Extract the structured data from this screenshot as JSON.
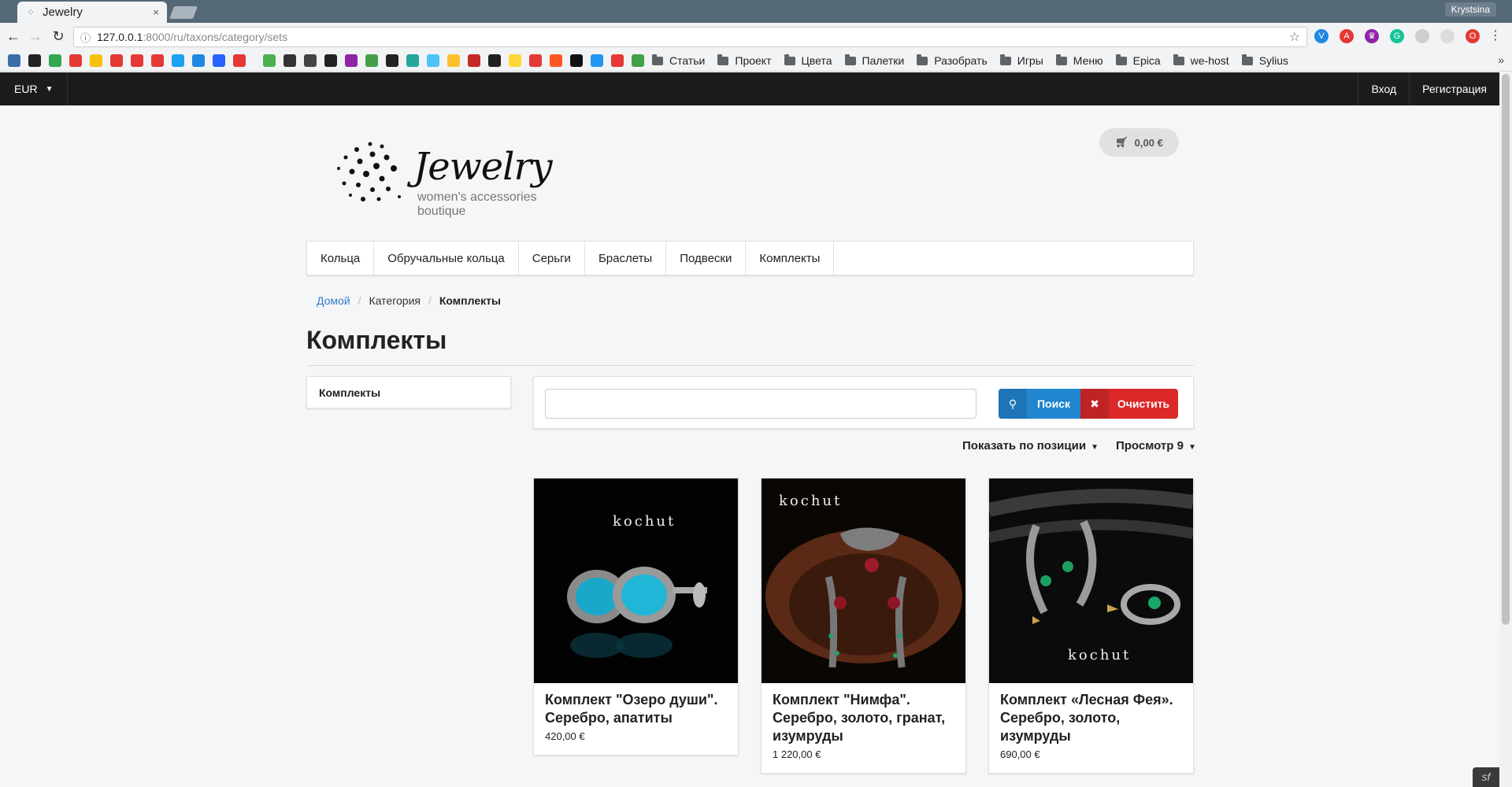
{
  "browser": {
    "tab_title": "Jewelry",
    "tab_close": "×",
    "profile_name": "Krystsina",
    "url_host": "127.0.0.1",
    "url_path": ":8000/ru/taxons/category/sets"
  },
  "bookmarks": {
    "folders": [
      "Статьи",
      "Проект",
      "Цвета",
      "Палетки",
      "Разобрать",
      "Игры",
      "Меню",
      "Epica",
      "we-host",
      "Sylius"
    ],
    "icon_colors": [
      "#3b6ea8",
      "#222222",
      "#32a852",
      "#e53935",
      "#f4c20d",
      "#e53935",
      "#e53935",
      "#e53935",
      "#1da1f2",
      "#1e88e5",
      "#2962ff",
      "#e53935",
      "#4caf50",
      "#333333",
      "#444444",
      "#222222",
      "#8e24aa",
      "#43a047",
      "#222222",
      "#26a69a",
      "#4fc3f7",
      "#fbc02d",
      "#c62828",
      "#212121",
      "#fdd835",
      "#e53935",
      "#ff5722",
      "#111111",
      "#2196f3",
      "#e53935",
      "#43a047"
    ]
  },
  "site": {
    "currency": "EUR",
    "login": "Вход",
    "register": "Регистрация",
    "cart_total": "0,00 €"
  },
  "logo": {
    "name": "Jewelry",
    "tagline": "women's accessories boutique"
  },
  "menu": [
    "Кольца",
    "Обручальные кольца",
    "Серьги",
    "Браслеты",
    "Подвески",
    "Комплекты"
  ],
  "breadcrumb": {
    "home": "Домой",
    "sep": "/",
    "category": "Категория",
    "current": "Комплекты"
  },
  "page_title": "Комплекты",
  "sidebar": {
    "item": "Комплекты"
  },
  "filter": {
    "search_value": "",
    "search_button": "Поиск",
    "clear_button": "Очистить"
  },
  "sorting": {
    "sort_label": "Показать по позиции",
    "view_label": "Просмотр 9"
  },
  "products": [
    {
      "name": "Комплект \"Озеро души\". Серебро, апатиты",
      "price": "420,00 €",
      "brand": "kochut"
    },
    {
      "name": "Комплект \"Нимфа\". Серебро, золото, гранат, изумруды",
      "price": "1 220,00 €",
      "brand": "kochut"
    },
    {
      "name": "Комплект «Лесная Фея». Серебро, золото, изумруды",
      "price": "690,00 €",
      "brand": "kochut"
    }
  ],
  "colors": {
    "accent_blue": "#2185d0",
    "accent_red": "#db2828",
    "topbar": "#1b1c1d",
    "link": "#2f7bc9"
  }
}
